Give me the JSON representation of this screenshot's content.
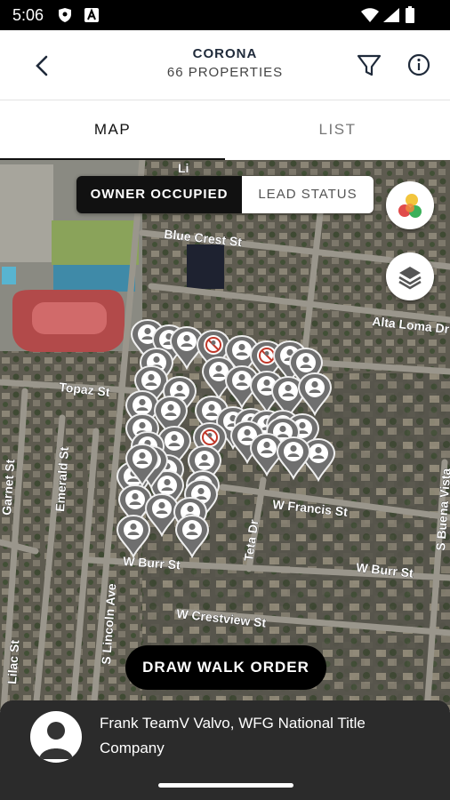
{
  "status_bar": {
    "time": "5:06"
  },
  "header": {
    "title": "CORONA",
    "subtitle": "66 PROPERTIES"
  },
  "tabs": {
    "map": "MAP",
    "list": "LIST"
  },
  "toggle": {
    "owner_occupied": "OWNER OCCUPIED",
    "lead_status": "LEAD STATUS"
  },
  "map": {
    "streets": {
      "blue_crest": "Blue Crest St",
      "blue_crest_right": "Blue",
      "alta_loma": "Alta Loma Dr",
      "topaz": "Topaz St",
      "garnet": "Garnet St",
      "emerald": "Emerald St",
      "w_francis": "W Francis St",
      "teta": "Teta Dr",
      "w_burr_left": "W Burr St",
      "w_burr_right": "W Burr St",
      "s_buena": "S Buena Vista",
      "w_crestview": "W Crestview St",
      "s_lincoln": "S Lincoln Ave",
      "lilac": "Lilac St",
      "top_cut": "Li"
    }
  },
  "actions": {
    "draw_walk_order": "DRAW WALK ORDER"
  },
  "agent": {
    "name": "Frank TeamV Valvo, WFG National Title Company"
  },
  "icons": {
    "back": "chevron-left-icon",
    "filter": "filter-icon",
    "info": "info-icon",
    "colors": "color-legend-icon",
    "layers": "layers-icon"
  },
  "colors": {
    "dark": "#111111",
    "footer": "#2b2b2b",
    "pin": "#6f6f6f",
    "brand_navy": "#1f2a3a"
  }
}
